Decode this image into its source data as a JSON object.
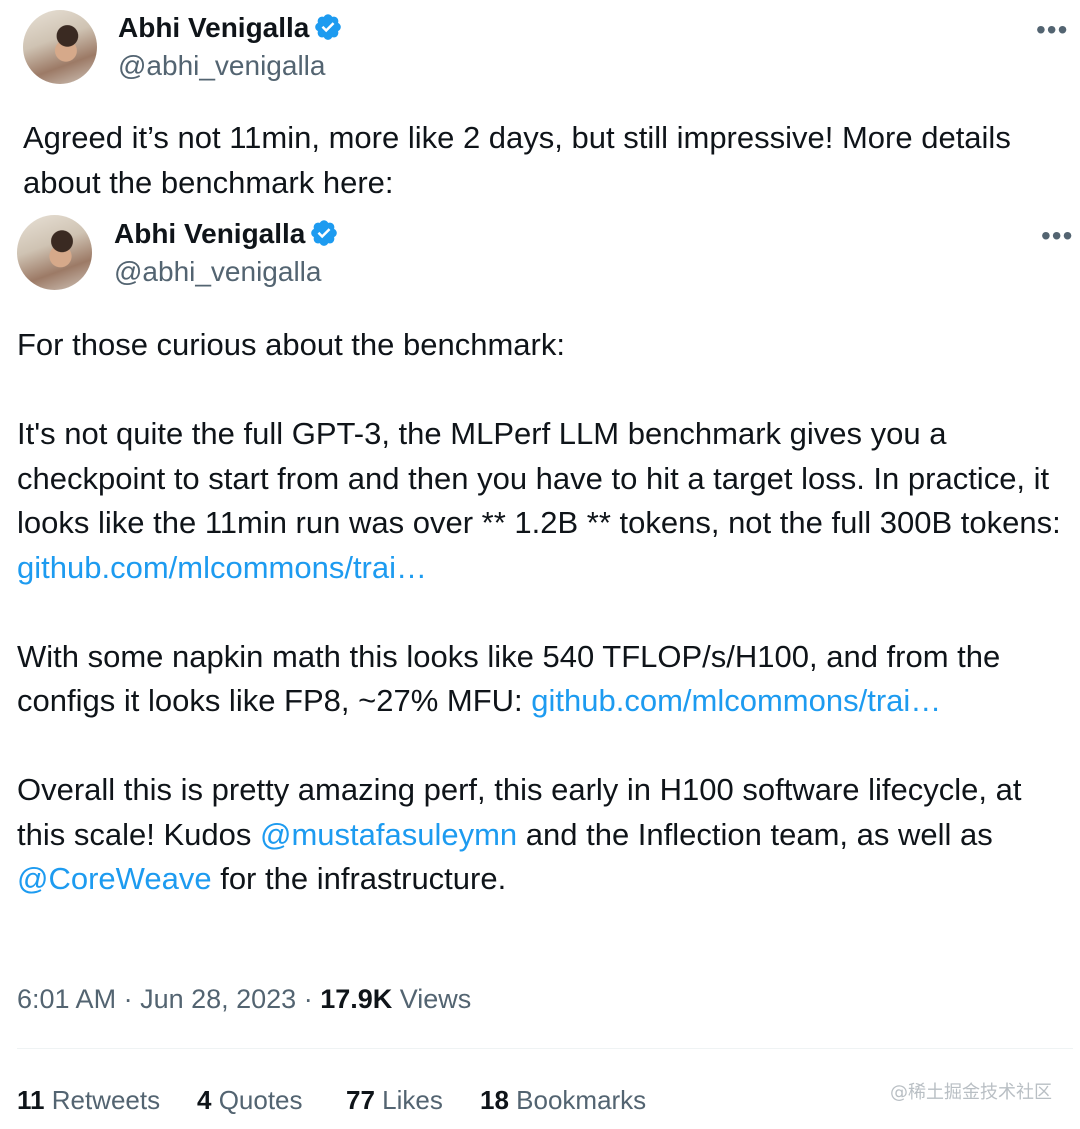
{
  "outer_tweet": {
    "author_name": "Abhi Venigalla",
    "handle": "@abhi_venigalla",
    "more_label": "•••",
    "text": "Agreed it’s not 11min, more like 2 days, but still impressive! More details about the benchmark here:"
  },
  "quoted_tweet": {
    "author_name": "Abhi Venigalla",
    "handle": "@abhi_venigalla",
    "more_label": "•••",
    "p1": "For those curious about the benchmark:",
    "p2_text": "It's not quite the full GPT-3, the MLPerf LLM benchmark gives you a checkpoint to start from and then you have to hit a target loss.  In practice, it looks like the 11min run was over ** 1.2B ** tokens, not the full 300B tokens: ",
    "p2_link": "github.com/mlcommons/trai…",
    "p3_text": "With some napkin math this looks like 540 TFLOP/s/H100, and from the configs it looks like FP8, ~27% MFU: ",
    "p3_link": "github.com/mlcommons/trai…",
    "p4_a": "Overall this is pretty amazing perf, this early in H100 software lifecycle, at this scale! Kudos ",
    "p4_mention1": "@mustafasuleymn",
    "p4_b": " and the Inflection team, as well as ",
    "p4_mention2": "@CoreWeave",
    "p4_c": " for the infrastructure."
  },
  "meta": {
    "time": "6:01 AM",
    "sep1": " · ",
    "date": "Jun 28, 2023",
    "sep2": " · ",
    "views_count": "17.9K",
    "views_label": " Views"
  },
  "stats": {
    "retweets_count": "11",
    "retweets_label": " Retweets",
    "quotes_count": "4",
    "quotes_label": " Quotes",
    "likes_count": "77",
    "likes_label": " Likes",
    "bookmarks_count": "18",
    "bookmarks_label": " Bookmarks"
  },
  "watermark": "@稀土掘金技术社区",
  "colors": {
    "link": "#1d9bf0",
    "verified": "#1d9bf0",
    "secondary": "#536471"
  },
  "icons": {
    "verified": "verified-badge-icon",
    "more": "more-horizontal-icon"
  }
}
